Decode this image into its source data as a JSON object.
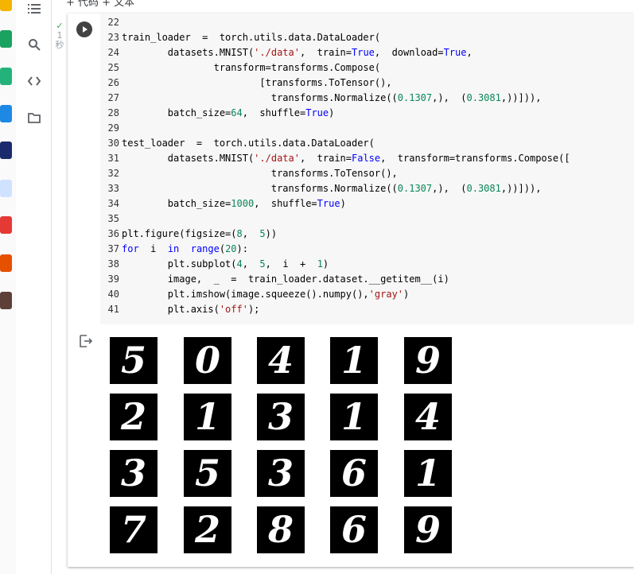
{
  "topbar": {
    "partial_text": "+ 代码   + 文本"
  },
  "exec_status": {
    "check": "✓",
    "count": "1",
    "unit": "秒"
  },
  "code_lines": [
    {
      "n": "22",
      "text": ""
    },
    {
      "n": "23",
      "text": "train_loader  =  torch.utils.data.DataLoader("
    },
    {
      "n": "24",
      "text": "        datasets.MNIST('./data',  train=True,  download=True,"
    },
    {
      "n": "25",
      "text": "                transform=transforms.Compose("
    },
    {
      "n": "26",
      "text": "                        [transforms.ToTensor(),"
    },
    {
      "n": "27",
      "text": "                          transforms.Normalize((0.1307,),  (0.3081,))])),"
    },
    {
      "n": "28",
      "text": "        batch_size=64,  shuffle=True)"
    },
    {
      "n": "29",
      "text": ""
    },
    {
      "n": "30",
      "text": "test_loader  =  torch.utils.data.DataLoader("
    },
    {
      "n": "31",
      "text": "        datasets.MNIST('./data',  train=False,  transform=transforms.Compose(["
    },
    {
      "n": "32",
      "text": "                          transforms.ToTensor(),"
    },
    {
      "n": "33",
      "text": "                          transforms.Normalize((0.1307,),  (0.3081,))])),"
    },
    {
      "n": "34",
      "text": "        batch_size=1000,  shuffle=True)"
    },
    {
      "n": "35",
      "text": ""
    },
    {
      "n": "36",
      "text": "plt.figure(figsize=(8,  5))"
    },
    {
      "n": "37",
      "text": "for  i  in  range(20):"
    },
    {
      "n": "38",
      "text": "        plt.subplot(4,  5,  i  +  1)"
    },
    {
      "n": "39",
      "text": "        image,  _  =  train_loader.dataset.__getitem__(i)"
    },
    {
      "n": "40",
      "text": "        plt.imshow(image.squeeze().numpy(),'gray')"
    },
    {
      "n": "41",
      "text": "        plt.axis('off');"
    }
  ],
  "output": {
    "digits": [
      "5",
      "0",
      "4",
      "1",
      "9",
      "2",
      "1",
      "3",
      "1",
      "4",
      "3",
      "5",
      "3",
      "6",
      "1",
      "7",
      "2",
      "8",
      "6",
      "9"
    ]
  },
  "icons": {
    "sidebar": [
      "menu-icon",
      "search-icon",
      "code-icon",
      "folder-icon"
    ],
    "output": "output-toggle-icon",
    "run": "play-icon"
  },
  "colors": {
    "keyword": "#0000ff",
    "number": "#098658",
    "string": "#a31515",
    "success": "#34a853"
  }
}
